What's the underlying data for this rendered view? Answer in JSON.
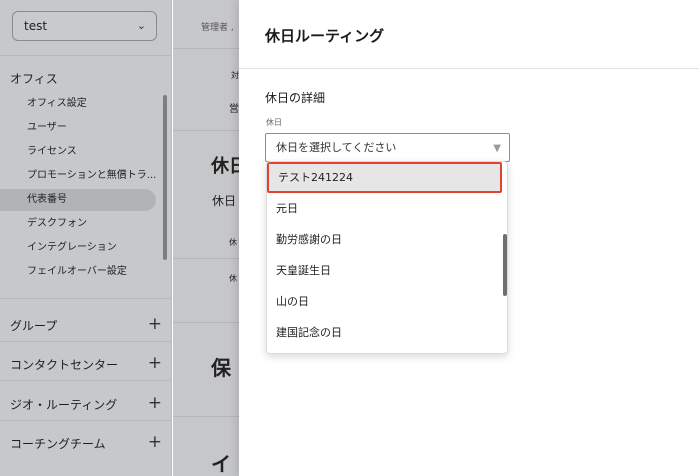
{
  "workspace": {
    "value": "test"
  },
  "sidebar": {
    "section_title": "オフィス",
    "items": [
      {
        "label": "オフィス設定"
      },
      {
        "label": "ユーザー"
      },
      {
        "label": "ライセンス"
      },
      {
        "label": "プロモーションと無償トラ..."
      },
      {
        "label": "代表番号"
      },
      {
        "label": "デスクフォン"
      },
      {
        "label": "インテグレーション"
      },
      {
        "label": "フェイルオーバー設定"
      }
    ],
    "groups": [
      {
        "label": "グループ"
      },
      {
        "label": "コンタクトセンター"
      },
      {
        "label": "ジオ・ルーティング"
      },
      {
        "label": "コーチングチーム"
      }
    ]
  },
  "background": {
    "breadcrumb": "管理者 ,",
    "fragments": {
      "f1": "対",
      "f2": "営",
      "heading1": "休日",
      "sub1": "休日",
      "f3": "休",
      "f4": "休",
      "heading2": "保",
      "heading3": "イ"
    }
  },
  "drawer": {
    "title": "休日ルーティング",
    "section_title": "休日の詳細",
    "field_label": "休日",
    "select_placeholder": "休日を選択してください",
    "options": [
      {
        "label": "テスト241224",
        "highlighted": true
      },
      {
        "label": "元日"
      },
      {
        "label": "勤労感謝の日"
      },
      {
        "label": "天皇誕生日"
      },
      {
        "label": "山の日"
      },
      {
        "label": "建国記念の日"
      }
    ]
  },
  "icons": {
    "workspace_chevron": "chevron-down-icon",
    "select_caret": "caret-down-icon",
    "group_add": "plus-icon"
  }
}
